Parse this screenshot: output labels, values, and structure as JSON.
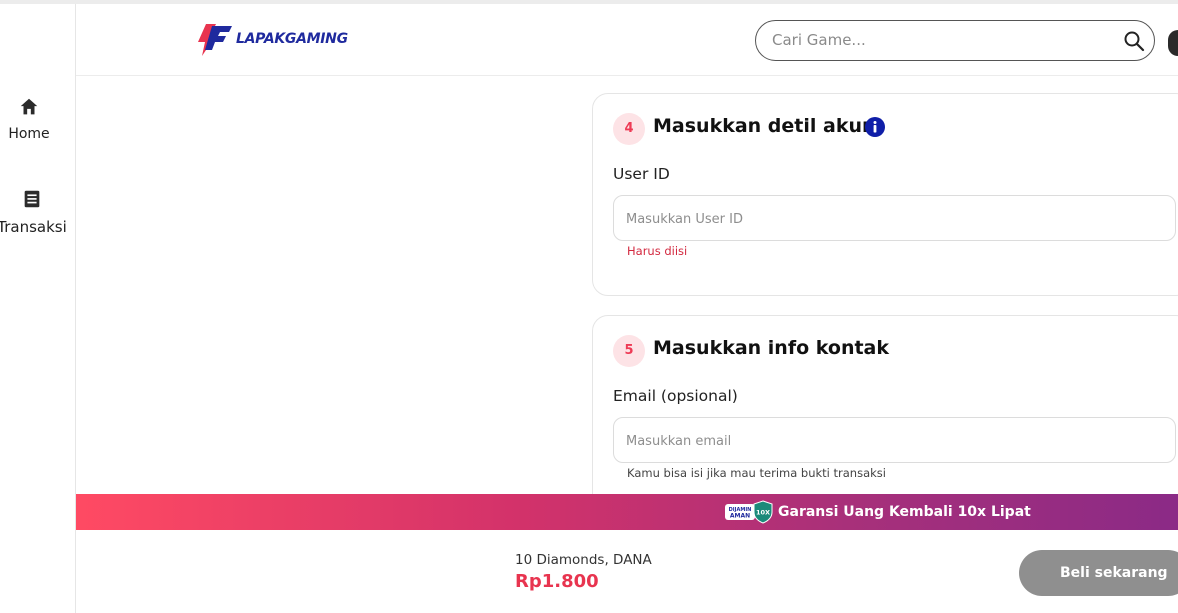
{
  "sidebar": {
    "items": [
      {
        "label": "Home",
        "icon": "home-icon"
      },
      {
        "label": "Transaksi",
        "icon": "receipt-icon"
      }
    ]
  },
  "header": {
    "logo_text": "LAPAKGAMING",
    "search": {
      "placeholder": "Cari Game...",
      "value": ""
    }
  },
  "account_section": {
    "step": "4",
    "title": "Masukkan detil akun",
    "field_label": "User ID",
    "placeholder": "Masukkan User ID",
    "error": "Harus diisi"
  },
  "contact_section": {
    "step": "5",
    "title": "Masukkan info kontak",
    "field_label": "Email (opsional)",
    "placeholder": "Masukkan email",
    "hint": "Kamu bisa isi jika mau terima bukti transaksi"
  },
  "guarantee": {
    "text": "Garansi Uang Kembali 10x Lipat",
    "badge_text_1": "DIJAMIN",
    "badge_text_2": "AMAN",
    "badge_text_3": "10X"
  },
  "checkout": {
    "description": "10 Diamonds, DANA",
    "price": "Rp1.800",
    "buy_label": "Beli sekarang"
  },
  "colors": {
    "brand": "#1f2a9e",
    "accent": "#e8344f",
    "info": "#0f1ea8"
  }
}
